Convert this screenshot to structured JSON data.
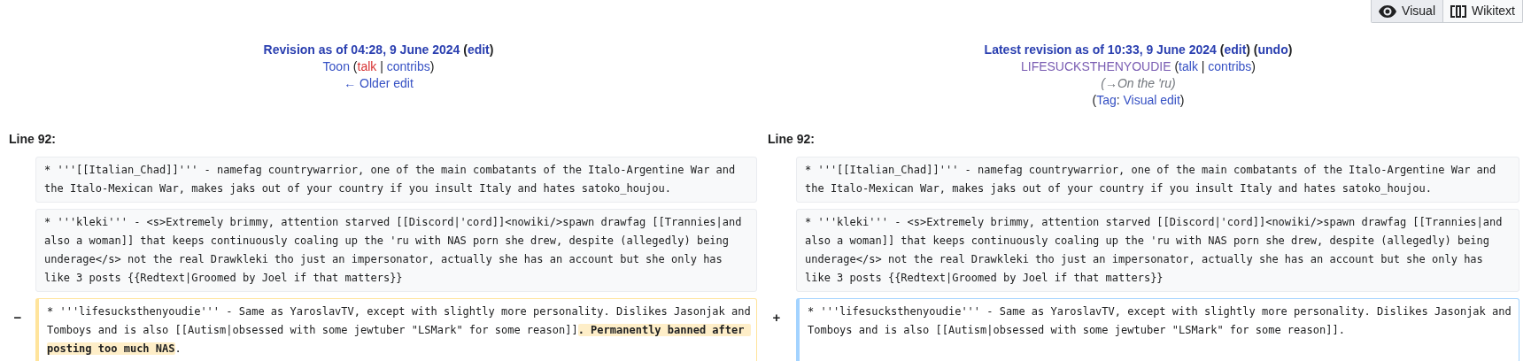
{
  "view_toggle": [
    {
      "label": "Visual",
      "kind": "eye",
      "selected": false
    },
    {
      "label": "Wikitext",
      "kind": "brackets",
      "selected": true
    }
  ],
  "headers": [
    {
      "lines": [
        [
          {
            "text": "Revision as of 04:28, 9 June 2024",
            "kind": "strong-link"
          },
          {
            "text": " (",
            "kind": "strong-plain"
          },
          {
            "text": "edit",
            "kind": "strong-link"
          },
          {
            "text": ")",
            "kind": "strong-plain"
          }
        ],
        [
          {
            "text": "Toon",
            "kind": "link"
          },
          {
            "text": " (",
            "kind": "plain"
          },
          {
            "text": "talk",
            "kind": "redlink"
          },
          {
            "text": " | ",
            "kind": "plain"
          },
          {
            "text": "contribs",
            "kind": "link"
          },
          {
            "text": ")",
            "kind": "plain"
          }
        ],
        [
          {
            "text": "← Older edit",
            "kind": "link"
          }
        ]
      ]
    },
    {
      "lines": [
        [
          {
            "text": "Latest revision as of 10:33, 9 June 2024",
            "kind": "strong-link"
          },
          {
            "text": " (",
            "kind": "strong-plain"
          },
          {
            "text": "edit",
            "kind": "strong-link"
          },
          {
            "text": ") (",
            "kind": "strong-plain"
          },
          {
            "text": "undo",
            "kind": "strong-link"
          },
          {
            "text": ")",
            "kind": "strong-plain"
          }
        ],
        [
          {
            "text": "LIFESUCKSTHENYOUDIE",
            "kind": "visited"
          },
          {
            "text": " (",
            "kind": "plain"
          },
          {
            "text": "talk",
            "kind": "link"
          },
          {
            "text": " | ",
            "kind": "plain"
          },
          {
            "text": "contribs",
            "kind": "link"
          },
          {
            "text": ")",
            "kind": "plain"
          }
        ],
        [
          {
            "text": "(→On the 'ru)",
            "kind": "comment"
          }
        ],
        [
          {
            "text": "(",
            "kind": "plain"
          },
          {
            "text": "Tag",
            "kind": "link"
          },
          {
            "text": ": ",
            "kind": "plain"
          },
          {
            "text": "Visual edit",
            "kind": "link"
          },
          {
            "text": ")",
            "kind": "plain"
          }
        ]
      ]
    }
  ],
  "line_labels": [
    "Line 92:",
    "Line 92:"
  ],
  "rows": [
    {
      "left": {
        "kind": "context",
        "segments": [
          {
            "text": "* '''[[Italian_Chad]]''' - namefag countrywarrior, one of the main combatants of the Italo-Argentine War and the Italo-Mexican War, makes jaks out of your country if you insult Italy and hates satoko_houjou.",
            "changed": false
          }
        ]
      },
      "right": {
        "kind": "context",
        "segments": [
          {
            "text": "* '''[[Italian_Chad]]''' - namefag countrywarrior, one of the main combatants of the Italo-Argentine War and the Italo-Mexican War, makes jaks out of your country if you insult Italy and hates satoko_houjou.",
            "changed": false
          }
        ]
      }
    },
    {
      "left": {
        "kind": "context",
        "segments": [
          {
            "text": "* '''kleki''' - <s>Extremely brimmy, attention starved [[Discord|'cord]]<nowiki/>spawn drawfag [[Trannies|and also a woman]] that keeps continuously coaling up the 'ru with NAS porn she drew, despite (allegedly) being underage</s> not the real Drawkleki tho just an impersonator, actually she has an account but she only has like 3 posts {{Redtext|Groomed by Joel if that matters}}",
            "changed": false
          }
        ]
      },
      "right": {
        "kind": "context",
        "segments": [
          {
            "text": "* '''kleki''' - <s>Extremely brimmy, attention starved [[Discord|'cord]]<nowiki/>spawn drawfag [[Trannies|and also a woman]] that keeps continuously coaling up the 'ru with NAS porn she drew, despite (allegedly) being underage</s> not the real Drawkleki tho just an impersonator, actually she has an account but she only has like 3 posts {{Redtext|Groomed by Joel if that matters}}",
            "changed": false
          }
        ]
      }
    },
    {
      "left": {
        "kind": "deleted",
        "marker": "−",
        "segments": [
          {
            "text": "* '''lifesucksthenyoudie''' - Same as YaroslavTV, except with slightly more personality. Dislikes Jasonjak and Tomboys and is also [[Autism|obsessed with some jewtuber \"LSMark\" for some reason]]",
            "changed": false
          },
          {
            "text": ". Permanently banned after posting too much NAS",
            "changed": true
          },
          {
            "text": ".",
            "changed": false
          }
        ]
      },
      "right": {
        "kind": "added",
        "marker": "+",
        "segments": [
          {
            "text": "* '''lifesucksthenyoudie''' - Same as YaroslavTV, except with slightly more personality. Dislikes Jasonjak and Tomboys and is also [[Autism|obsessed with some jewtuber \"LSMark\" for some reason]].",
            "changed": false
          }
        ]
      }
    }
  ]
}
